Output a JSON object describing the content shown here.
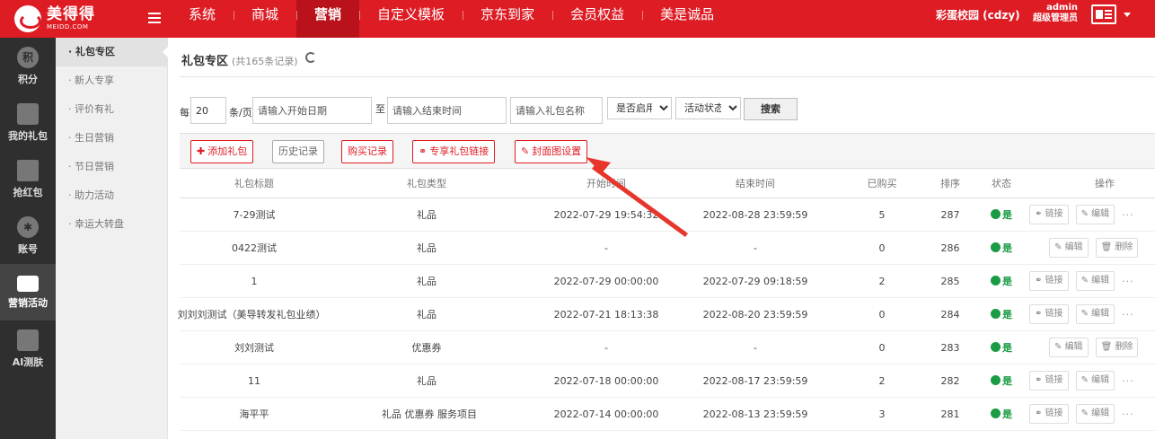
{
  "header": {
    "logo_name": "美得得",
    "logo_domain": "MEIDD.COM",
    "nav": [
      {
        "label": "系统"
      },
      {
        "label": "商城"
      },
      {
        "label": "营销"
      },
      {
        "label": "自定义模板"
      },
      {
        "label": "京东到家"
      },
      {
        "label": "会员权益"
      },
      {
        "label": "美是诚品"
      }
    ],
    "store_name": "彩蛋校园 (cdzy)",
    "username": "admin",
    "role": "超级管理员"
  },
  "sidebar": {
    "items": [
      {
        "label": "积分",
        "icon": "points-icon"
      },
      {
        "label": "我的礼包",
        "icon": "gift-bag-icon"
      },
      {
        "label": "抢红包",
        "icon": "red-envelope-icon"
      },
      {
        "label": "账号",
        "icon": "account-icon"
      },
      {
        "label": "营销活动",
        "icon": "card-icon"
      },
      {
        "label": "AI测肤",
        "icon": "lock-icon"
      }
    ]
  },
  "subnav": {
    "items": [
      {
        "label": "礼包专区"
      },
      {
        "label": "新人专享"
      },
      {
        "label": "评价有礼"
      },
      {
        "label": "生日营销"
      },
      {
        "label": "节日营销"
      },
      {
        "label": "助力活动"
      },
      {
        "label": "幸运大转盘"
      }
    ]
  },
  "page": {
    "title": "礼包专区",
    "count": "(共165条记录)"
  },
  "filter": {
    "per_prefix": "每",
    "per_value": "20",
    "per_suffix": "条/页",
    "start_placeholder": "请输入开始日期",
    "to": "至",
    "end_placeholder": "请输入结束时间",
    "name_placeholder": "请输入礼包名称",
    "enabled_select": "是否启用",
    "status_select": "活动状态",
    "search_label": "搜索"
  },
  "actions": {
    "add": "添加礼包",
    "history": "历史记录",
    "purchase": "购买记录",
    "exclusive_link": "专享礼包链接",
    "cover": "封面图设置"
  },
  "table": {
    "headers": [
      "礼包标题",
      "礼包类型",
      "开始时间",
      "结束时间",
      "已购买",
      "排序",
      "状态",
      "操作"
    ],
    "rows": [
      {
        "title": "7-29测试",
        "type": "礼品",
        "start": "2022-07-29 19:54:32",
        "end": "2022-08-28 23:59:59",
        "bought": "5",
        "sort": "287",
        "status": "是",
        "op1": "链接",
        "op2": "编辑"
      },
      {
        "title": "0422测试",
        "type": "礼品",
        "start": "-",
        "end": "-",
        "bought": "0",
        "sort": "286",
        "status": "是",
        "op1": "编辑",
        "op2": "删除"
      },
      {
        "title": "1",
        "type": "礼品",
        "start": "2022-07-29 00:00:00",
        "end": "2022-07-29 09:18:59",
        "bought": "2",
        "sort": "285",
        "status": "是",
        "op1": "链接",
        "op2": "编辑"
      },
      {
        "title": "刘刘刘测试（美导转发礼包业绩）",
        "type": "礼品",
        "start": "2022-07-21 18:13:38",
        "end": "2022-08-20 23:59:59",
        "bought": "0",
        "sort": "284",
        "status": "是",
        "op1": "链接",
        "op2": "编辑"
      },
      {
        "title": "刘刘测试",
        "type": "优惠券",
        "start": "-",
        "end": "-",
        "bought": "0",
        "sort": "283",
        "status": "是",
        "op1": "编辑",
        "op2": "删除"
      },
      {
        "title": "11",
        "type": "礼品",
        "start": "2022-07-18 00:00:00",
        "end": "2022-08-17 23:59:59",
        "bought": "2",
        "sort": "282",
        "status": "是",
        "op1": "链接",
        "op2": "编辑"
      },
      {
        "title": "海平平",
        "type": "礼品 优惠券 服务项目",
        "start": "2022-07-14 00:00:00",
        "end": "2022-08-13 23:59:59",
        "bought": "3",
        "sort": "281",
        "status": "是",
        "op1": "链接",
        "op2": "编辑"
      }
    ]
  },
  "colors": {
    "brand": "#de1c24",
    "status": "#1a9c44",
    "annotation_arrow": "#e8352b"
  }
}
